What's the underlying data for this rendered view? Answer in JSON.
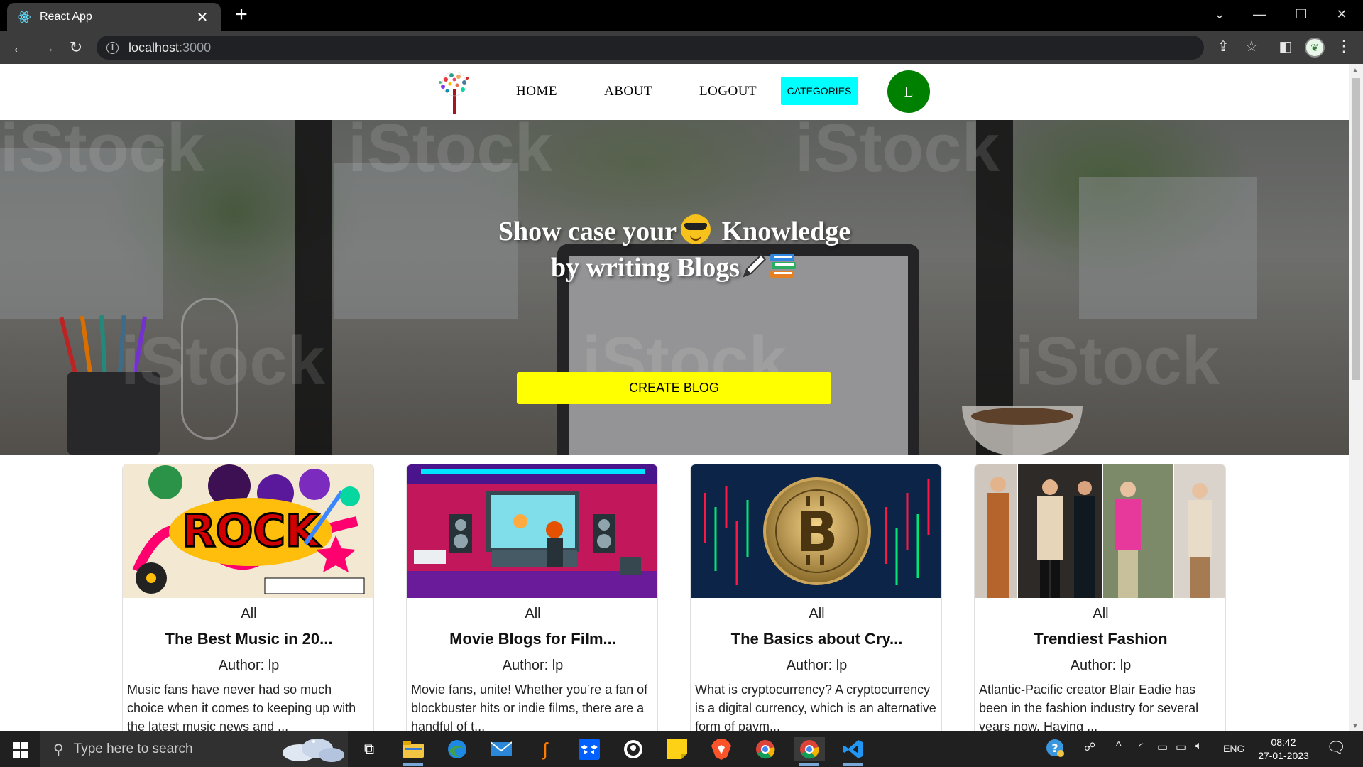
{
  "browser": {
    "tab_title": "React App",
    "url_host": "localhost",
    "url_port": ":3000"
  },
  "nav": {
    "home": "HOME",
    "about": "ABOUT",
    "logout": "LOGOUT",
    "categories": "CATEGORIES",
    "avatar_initial": "L"
  },
  "hero": {
    "line1_a": "Show case your",
    "line1_b": "Knowledge",
    "line2": "by writing Blogs",
    "create_button": "CREATE BLOG",
    "watermarks": [
      "iStock",
      "iStock",
      "iStock",
      "iStock",
      "iStock",
      "iStock"
    ]
  },
  "posts": [
    {
      "category": "All",
      "title": "The Best Music in 20...",
      "author": "Author: lp",
      "description": "Music fans have never had so much choice when it comes to keeping up with the latest music news and ..."
    },
    {
      "category": "All",
      "title": "Movie Blogs for Film...",
      "author": "Author: lp",
      "description": "Movie fans, unite! Whether you’re a fan of blockbuster hits or indie films, there are a handful of t..."
    },
    {
      "category": "All",
      "title": "The Basics about Cry...",
      "author": "Author: lp",
      "description": "What is cryptocurrency? A cryptocurrency is a digital currency, which is an alternative form of paym..."
    },
    {
      "category": "All",
      "title": "Trendiest Fashion",
      "author": "Author: lp",
      "description": "Atlantic-Pacific creator Blair Eadie has been in the fashion industry for several years now. Having ..."
    }
  ],
  "taskbar": {
    "search_placeholder": "Type here to search",
    "language": "ENG",
    "time": "08:42",
    "date": "27-01-2023"
  },
  "colors": {
    "categories_button": "#00ffff",
    "create_button": "#ffff00",
    "avatar": "#008000"
  }
}
